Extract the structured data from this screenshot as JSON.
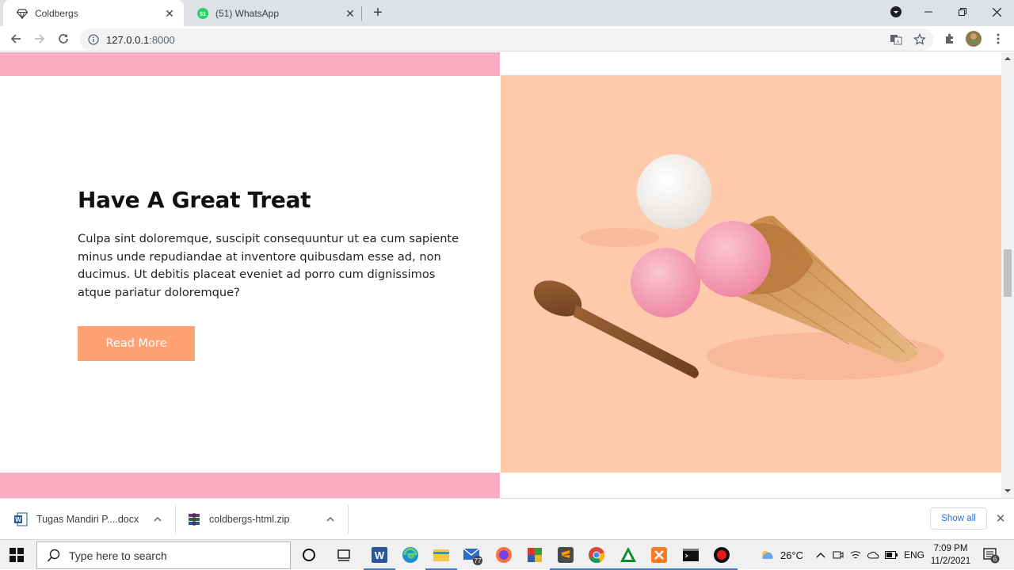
{
  "browser": {
    "tabs": [
      {
        "title": "Coldbergs",
        "active": true,
        "icon": "diamond-icon"
      },
      {
        "title": "(51) WhatsApp",
        "active": false,
        "icon": "whatsapp-icon",
        "badge": "51"
      }
    ],
    "address": {
      "host": "127.0.0.1",
      "port": ":8000"
    },
    "toolbar_icons": [
      "translate-icon",
      "star-icon",
      "extensions-icon",
      "profile-avatar",
      "menu-icon"
    ]
  },
  "page": {
    "heading": "Have A Great Treat",
    "body": "Culpa sint doloremque, suscipit consequuntur ut ea cum sapiente minus unde repudiandae at inventore quibusdam esse ad, non ducimus. Ut debitis placeat eveniet ad porro cum dignissimos atque pariatur doloremque?",
    "button": "Read More",
    "colors": {
      "pink_band": "#f9adc2",
      "image_bg": "#ffc9ab",
      "button": "#ffa173"
    }
  },
  "downloads": {
    "items": [
      {
        "name": "Tugas  Mandiri P....docx",
        "icon": "word-doc-icon"
      },
      {
        "name": "coldbergs-html.zip",
        "icon": "zip-archive-icon"
      }
    ],
    "show_all": "Show all"
  },
  "taskbar": {
    "search_placeholder": "Type here to search",
    "mail_badge": "77",
    "weather": "26°C",
    "language": "ENG",
    "time": "7:09 PM",
    "date": "11/2/2021",
    "notifications": "6"
  }
}
